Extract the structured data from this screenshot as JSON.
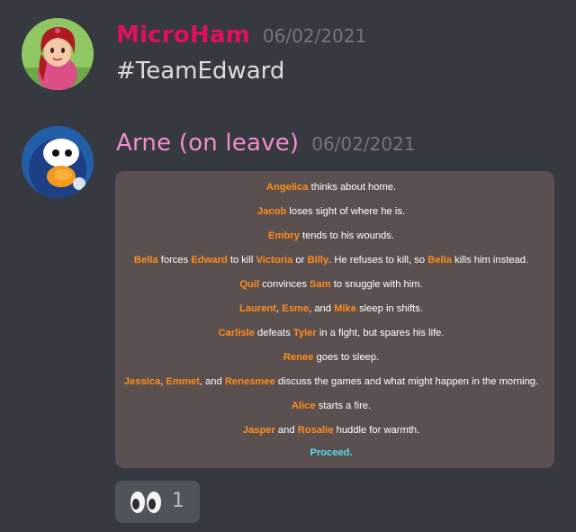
{
  "colors": {
    "background": "#36393f",
    "microham_name": "#e0105f",
    "arne_name": "#f08cd2",
    "timestamp": "#72767d",
    "message_text": "#dcddde",
    "panel_background": "#5b5050",
    "tribute_name": "#ff8c1a",
    "proceed_link": "#55ddee",
    "reaction_bg": "#4f545c"
  },
  "messages": [
    {
      "username": "MicroHam",
      "timestamp": "06/02/2021",
      "text": "#TeamEdward",
      "avatar": "princess-avatar-icon"
    },
    {
      "username": "Arne (on leave)",
      "timestamp": "06/02/2021",
      "avatar": "penguin-avatar-icon",
      "game_events": [
        [
          {
            "n": "Angelica"
          },
          {
            "t": " thinks about home."
          }
        ],
        [
          {
            "n": "Jacob"
          },
          {
            "t": " loses sight of where he is."
          }
        ],
        [
          {
            "n": "Embry"
          },
          {
            "t": " tends to his wounds."
          }
        ],
        [
          {
            "n": "Bella"
          },
          {
            "t": " forces "
          },
          {
            "n": "Edward"
          },
          {
            "t": " to kill "
          },
          {
            "n": "Victoria"
          },
          {
            "t": " or "
          },
          {
            "n": "Billy"
          },
          {
            "t": ". He refuses to kill, so "
          },
          {
            "n": "Bella"
          },
          {
            "t": " kills him instead."
          }
        ],
        [
          {
            "n": "Quil"
          },
          {
            "t": " convinces "
          },
          {
            "n": "Sam"
          },
          {
            "t": " to snuggle with him."
          }
        ],
        [
          {
            "n": "Laurent"
          },
          {
            "t": ", "
          },
          {
            "n": "Esme"
          },
          {
            "t": ", and "
          },
          {
            "n": "Mike"
          },
          {
            "t": " sleep in shifts."
          }
        ],
        [
          {
            "n": "Carlisle"
          },
          {
            "t": " defeats "
          },
          {
            "n": "Tyler"
          },
          {
            "t": " in a fight, but spares his life."
          }
        ],
        [
          {
            "n": "Renee"
          },
          {
            "t": " goes to sleep."
          }
        ],
        [
          {
            "n": "Jessica"
          },
          {
            "t": ", "
          },
          {
            "n": "Emmet"
          },
          {
            "t": ", and "
          },
          {
            "n": "Renesmee"
          },
          {
            "t": " discuss the games and what might happen in the morning."
          }
        ],
        [
          {
            "n": "Alice"
          },
          {
            "t": " starts a fire."
          }
        ],
        [
          {
            "n": "Jasper"
          },
          {
            "t": " and "
          },
          {
            "n": "Rosalie"
          },
          {
            "t": " huddle for warmth."
          }
        ]
      ],
      "proceed_label": "Proceed."
    }
  ],
  "reaction": {
    "emoji": "eyes-emoji-icon",
    "count": "1"
  }
}
